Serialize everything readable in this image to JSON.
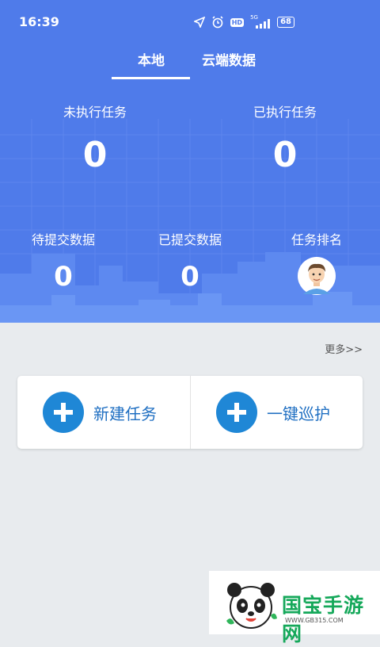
{
  "status_bar": {
    "time": "16:39",
    "hd": "HD",
    "network": "5G",
    "battery": "68"
  },
  "tabs": [
    {
      "label": "本地",
      "active": true
    },
    {
      "label": "云端数据",
      "active": false
    }
  ],
  "stats": {
    "not_executed": {
      "label": "未执行任务",
      "value": "0"
    },
    "executed": {
      "label": "已执行任务",
      "value": "0"
    },
    "pending_submit": {
      "label": "待提交数据",
      "value": "0"
    },
    "submitted": {
      "label": "已提交数据",
      "value": "0"
    },
    "ranking": {
      "label": "任务排名"
    }
  },
  "more_link": "更多>>",
  "actions": [
    {
      "label": "新建任务",
      "icon": "plus-icon"
    },
    {
      "label": "一键巡护",
      "icon": "plus-icon"
    }
  ],
  "watermark": {
    "text": "国宝手游网",
    "url": "WWW.GB315.COM"
  },
  "colors": {
    "header_blue": "#4f7bea",
    "action_blue": "#1f87d6",
    "page_bg": "#e8ebee"
  }
}
